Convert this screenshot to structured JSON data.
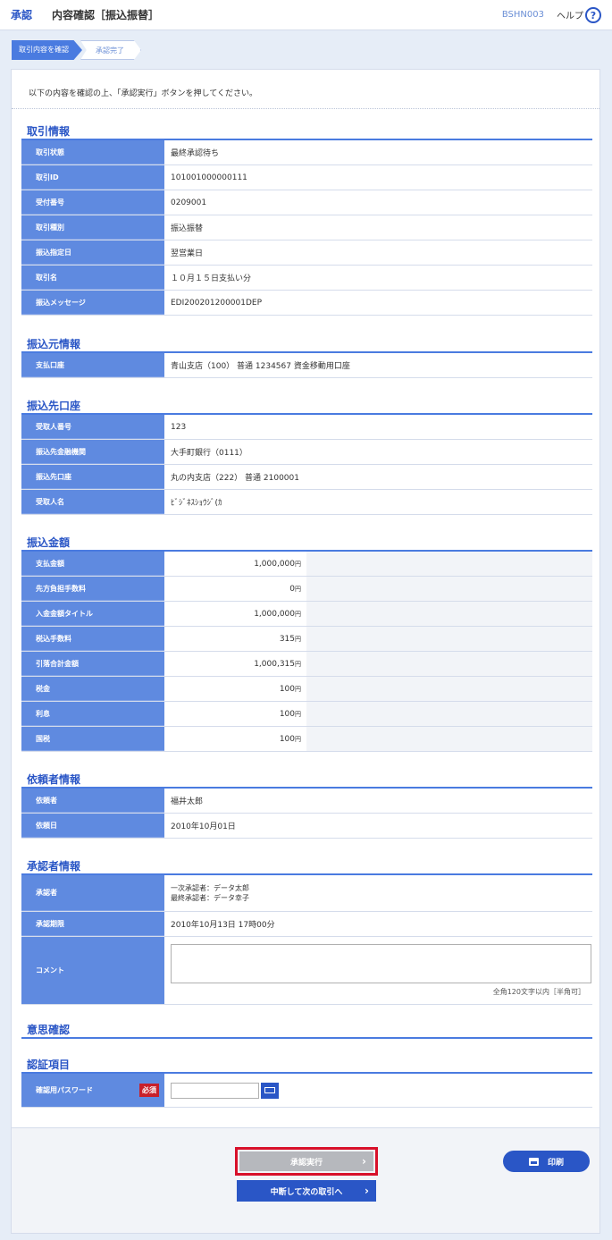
{
  "header": {
    "category": "承認",
    "title": "内容確認［振込振替］",
    "screen_code": "BSHN003",
    "help_label": "ヘルプ",
    "help_icon": "?"
  },
  "steps": [
    {
      "label": "取引内容を確認"
    },
    {
      "label": "承認完了"
    }
  ],
  "intro": "以下の内容を確認の上、「承認実行」ボタンを押してください。",
  "sections": {
    "transaction": {
      "title": "取引情報",
      "rows": [
        {
          "label": "取引状態",
          "value": "最終承認待ち"
        },
        {
          "label": "取引ID",
          "value": "101001000000111"
        },
        {
          "label": "受付番号",
          "value": "0209001"
        },
        {
          "label": "取引種別",
          "value": "振込振替"
        },
        {
          "label": "振込指定日",
          "value": "翌営業日"
        },
        {
          "label": "取引名",
          "value": "１０月１５日支払い分"
        },
        {
          "label": "振込メッセージ",
          "value": "EDI200201200001DEP"
        }
      ]
    },
    "source": {
      "title": "振込元情報",
      "rows": [
        {
          "label": "支払口座",
          "value": "青山支店（100） 普通 1234567 資金移動用口座"
        }
      ]
    },
    "destination": {
      "title": "振込先口座",
      "rows": [
        {
          "label": "受取人番号",
          "value": "123"
        },
        {
          "label": "振込先金融機関",
          "value": "大手町銀行（0111）"
        },
        {
          "label": "振込先口座",
          "value": "丸の内支店（222） 普通 2100001"
        },
        {
          "label": "受取人名",
          "value": "ﾋﾞｼﾞﾈｽｼｮｳｼﾞ(ｶ"
        }
      ]
    },
    "amount": {
      "title": "振込金額",
      "unit": "円",
      "rows": [
        {
          "label": "支払金額",
          "value": "1,000,000"
        },
        {
          "label": "先方負担手数料",
          "value": "0"
        },
        {
          "label": "入金金額タイトル",
          "value": "1,000,000"
        },
        {
          "label": "税込手数料",
          "value": "315"
        },
        {
          "label": "引落合計金額",
          "value": "1,000,315"
        },
        {
          "label": "税金",
          "value": "100"
        },
        {
          "label": "利息",
          "value": "100"
        },
        {
          "label": "国税",
          "value": "100"
        }
      ]
    },
    "requester": {
      "title": "依頼者情報",
      "rows": [
        {
          "label": "依頼者",
          "value": "福井太郎"
        },
        {
          "label": "依頼日",
          "value": "2010年10月01日"
        }
      ]
    },
    "approver": {
      "title": "承認者情報",
      "approver_label": "承認者",
      "approver_line1": "一次承認者：データ太郎",
      "approver_line2": "最終承認者：データ幸子",
      "deadline_label": "承認期限",
      "deadline_value": "2010年10月13日 17時00分",
      "comment_label": "コメント",
      "comment_value": "",
      "comment_hint": "全角120文字以内［半角可］"
    },
    "intent": {
      "title": "意思確認"
    },
    "auth": {
      "title": "認証項目",
      "password_label": "確認用パスワード",
      "required_badge": "必須",
      "password_value": ""
    }
  },
  "buttons": {
    "execute": "承認実行",
    "suspend": "中断して次の取引へ",
    "print": "印刷"
  },
  "colors": {
    "accent": "#2a56c6",
    "label_bg": "#5f8ae0",
    "highlight_border": "#d8102a",
    "required": "#c8202a"
  }
}
